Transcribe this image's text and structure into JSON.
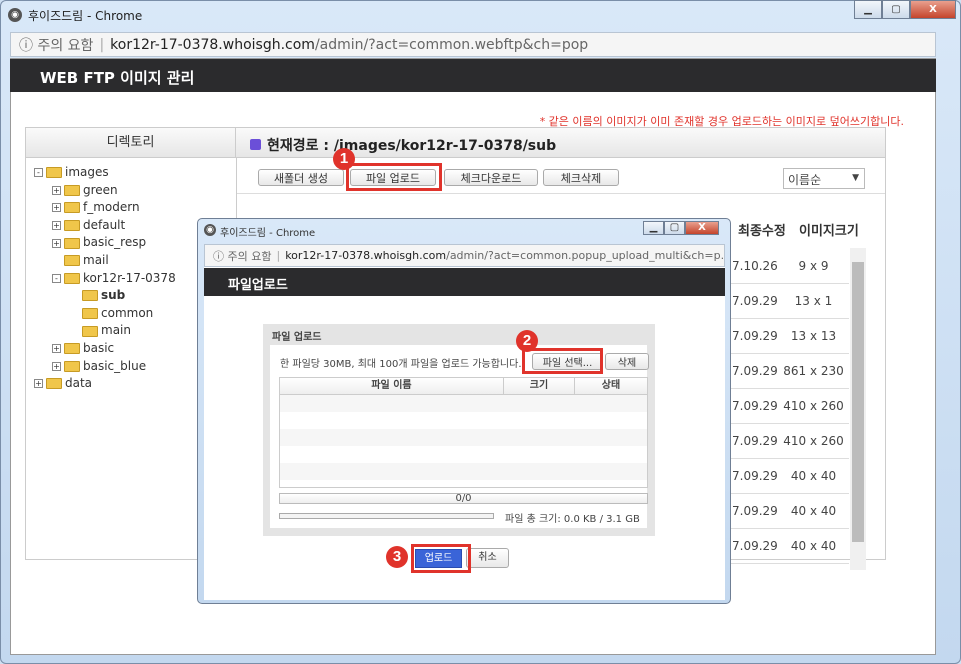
{
  "window": {
    "title": "후이즈드림 - Chrome",
    "address_warning": "주의 요함",
    "address_host": "kor12r-17-0378.whoisgh.com",
    "address_path": "/admin/?act=common.webftp&ch=pop"
  },
  "page": {
    "header": "WEB FTP 이미지 관리",
    "notice": "* 같은 이름의 이미지가 이미 존재할 경우 업로드하는 이미지로 덮어쓰기합니다.",
    "directory_label": "디렉토리",
    "current_path": "현재경로 : /images/kor12r-17-0378/sub"
  },
  "toolbar": {
    "new_folder": "새폴더 생성",
    "file_upload": "파일 업로드",
    "check_download": "체크다운로드",
    "check_delete": "체크삭제",
    "sort": "이름순"
  },
  "tree": [
    {
      "label": "images",
      "level": 0,
      "toggle": "-"
    },
    {
      "label": "green",
      "level": 1,
      "toggle": "+"
    },
    {
      "label": "f_modern",
      "level": 1,
      "toggle": "+"
    },
    {
      "label": "default",
      "level": 1,
      "toggle": "+"
    },
    {
      "label": "basic_resp",
      "level": 1,
      "toggle": "+"
    },
    {
      "label": "mail",
      "level": 1,
      "toggle": ""
    },
    {
      "label": "kor12r-17-0378",
      "level": 1,
      "toggle": "-"
    },
    {
      "label": "sub",
      "level": 2,
      "toggle": "",
      "selected": true
    },
    {
      "label": "common",
      "level": 2,
      "toggle": ""
    },
    {
      "label": "main",
      "level": 2,
      "toggle": ""
    },
    {
      "label": "basic",
      "level": 1,
      "toggle": "+"
    },
    {
      "label": "basic_blue",
      "level": 1,
      "toggle": "+"
    },
    {
      "label": "data",
      "level": 0,
      "toggle": "+"
    }
  ],
  "files": {
    "columns": [
      "최종수정",
      "이미지크기"
    ],
    "rows": [
      [
        "7.10.26",
        "9 x 9"
      ],
      [
        "7.09.29",
        "13 x 1"
      ],
      [
        "7.09.29",
        "13 x 13"
      ],
      [
        "7.09.29",
        "861 x 230"
      ],
      [
        "7.09.29",
        "410 x 260"
      ],
      [
        "7.09.29",
        "410 x 260"
      ],
      [
        "7.09.29",
        "40 x 40"
      ],
      [
        "7.09.29",
        "40 x 40"
      ],
      [
        "7.09.29",
        "40 x 40"
      ]
    ]
  },
  "popup": {
    "title": "후이즈드림 - Chrome",
    "address_warning": "주의 요함",
    "address_host": "kor12r-17-0378.whoisgh.com",
    "address_path": "/admin/?act=common.popup_upload_multi&ch=p...",
    "header": "파일업로드",
    "box_title": "파일 업로드",
    "limit_text": "한 파일당 30MB, 최대 100개 파일을 업로드 가능합니다.",
    "select_button": "파일 선택...",
    "delete_button": "삭제",
    "columns": [
      "파일 이름",
      "크기",
      "상태"
    ],
    "progress_count": "0/0",
    "progress_percent": 0,
    "total_size": "파일 총 크기: 0.0 KB / 3.1 GB",
    "upload_button": "업로드",
    "cancel_button": "취소"
  },
  "steps": [
    "1",
    "2",
    "3"
  ],
  "colors": {
    "step_red": "#e0332b",
    "header_dark": "#2b2b2d",
    "upload_blue": "#3a64d8"
  }
}
